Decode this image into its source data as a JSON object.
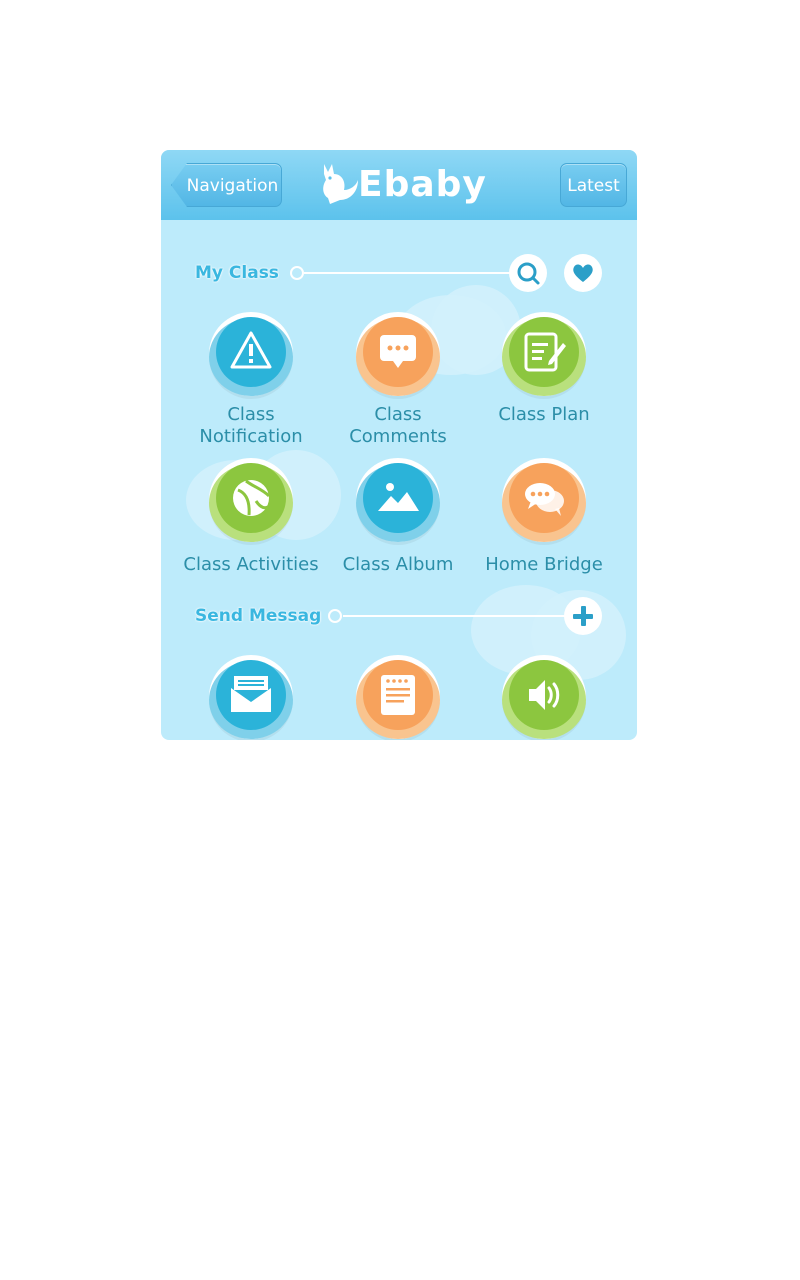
{
  "header": {
    "back_label": "Navigation",
    "latest_label": "Latest",
    "logo_text": "Ebaby"
  },
  "my_class": {
    "title": "My Class",
    "items": [
      {
        "label": "Class\nNotification",
        "icon": "alert-icon",
        "color": "#2bb3d9"
      },
      {
        "label": "Class\nComments",
        "icon": "chat-bubble-icon",
        "color": "#f7a25c"
      },
      {
        "label": "Class Plan",
        "icon": "edit-note-icon",
        "color": "#8cc63f"
      },
      {
        "label": "Class Activities",
        "icon": "ball-icon",
        "color": "#8cc63f"
      },
      {
        "label": "Class Album",
        "icon": "image-icon",
        "color": "#2bb3d9"
      },
      {
        "label": "Home Bridge",
        "icon": "conversation-icon",
        "color": "#f7a25c"
      }
    ]
  },
  "send_message": {
    "title": "Send Messag",
    "items": [
      {
        "icon": "mail-icon",
        "color": "#2bb3d9"
      },
      {
        "icon": "notepad-icon",
        "color": "#f7a25c"
      },
      {
        "icon": "speaker-icon",
        "color": "#8cc63f"
      }
    ]
  },
  "colors": {
    "background": "#bdebfb",
    "header": "#5cc2ec",
    "text": "#2b8ea8",
    "accent": "#3ab7e0"
  }
}
